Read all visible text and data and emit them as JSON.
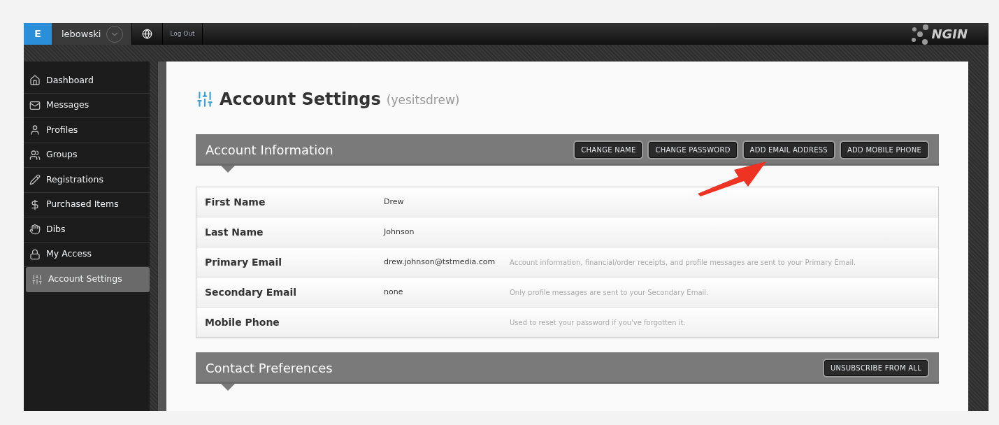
{
  "top_bar": {
    "badge": "E",
    "username": "lebowski",
    "logout": "Log Out",
    "logo": "NGIN"
  },
  "sidebar": {
    "items": [
      {
        "label": "Dashboard",
        "selected": false
      },
      {
        "label": "Messages",
        "selected": false
      },
      {
        "label": "Profiles",
        "selected": false
      },
      {
        "label": "Groups",
        "selected": false
      },
      {
        "label": "Registrations",
        "selected": false
      },
      {
        "label": "Purchased Items",
        "selected": false
      },
      {
        "label": "Dibs",
        "selected": false
      },
      {
        "label": "My Access",
        "selected": false
      },
      {
        "label": "Account Settings",
        "selected": true
      }
    ]
  },
  "page": {
    "title": "Account Settings",
    "subtitle": "(yesitsdrew)"
  },
  "account_information": {
    "title": "Account Information",
    "buttons": [
      "CHANGE NAME",
      "CHANGE PASSWORD",
      "ADD EMAIL ADDRESS",
      "ADD MOBILE PHONE"
    ],
    "rows": [
      {
        "label": "First Name",
        "value": "Drew"
      },
      {
        "label": "Last Name",
        "value": "Johnson"
      },
      {
        "label": "Primary Email",
        "value": "drew.johnson@tstmedia.com",
        "note": "Account information, financial/order receipts, and profile messages are sent to your Primary Email."
      },
      {
        "label": "Secondary Email",
        "value": "none",
        "note": "Only profile messages are sent to your Secondary Email."
      },
      {
        "label": "Mobile Phone",
        "note": "Used to reset your password if you've forgotten it."
      }
    ]
  },
  "contact_preferences": {
    "title": "Contact Preferences",
    "buttons": [
      "UNSUBSCRIBE FROM ALL"
    ]
  }
}
